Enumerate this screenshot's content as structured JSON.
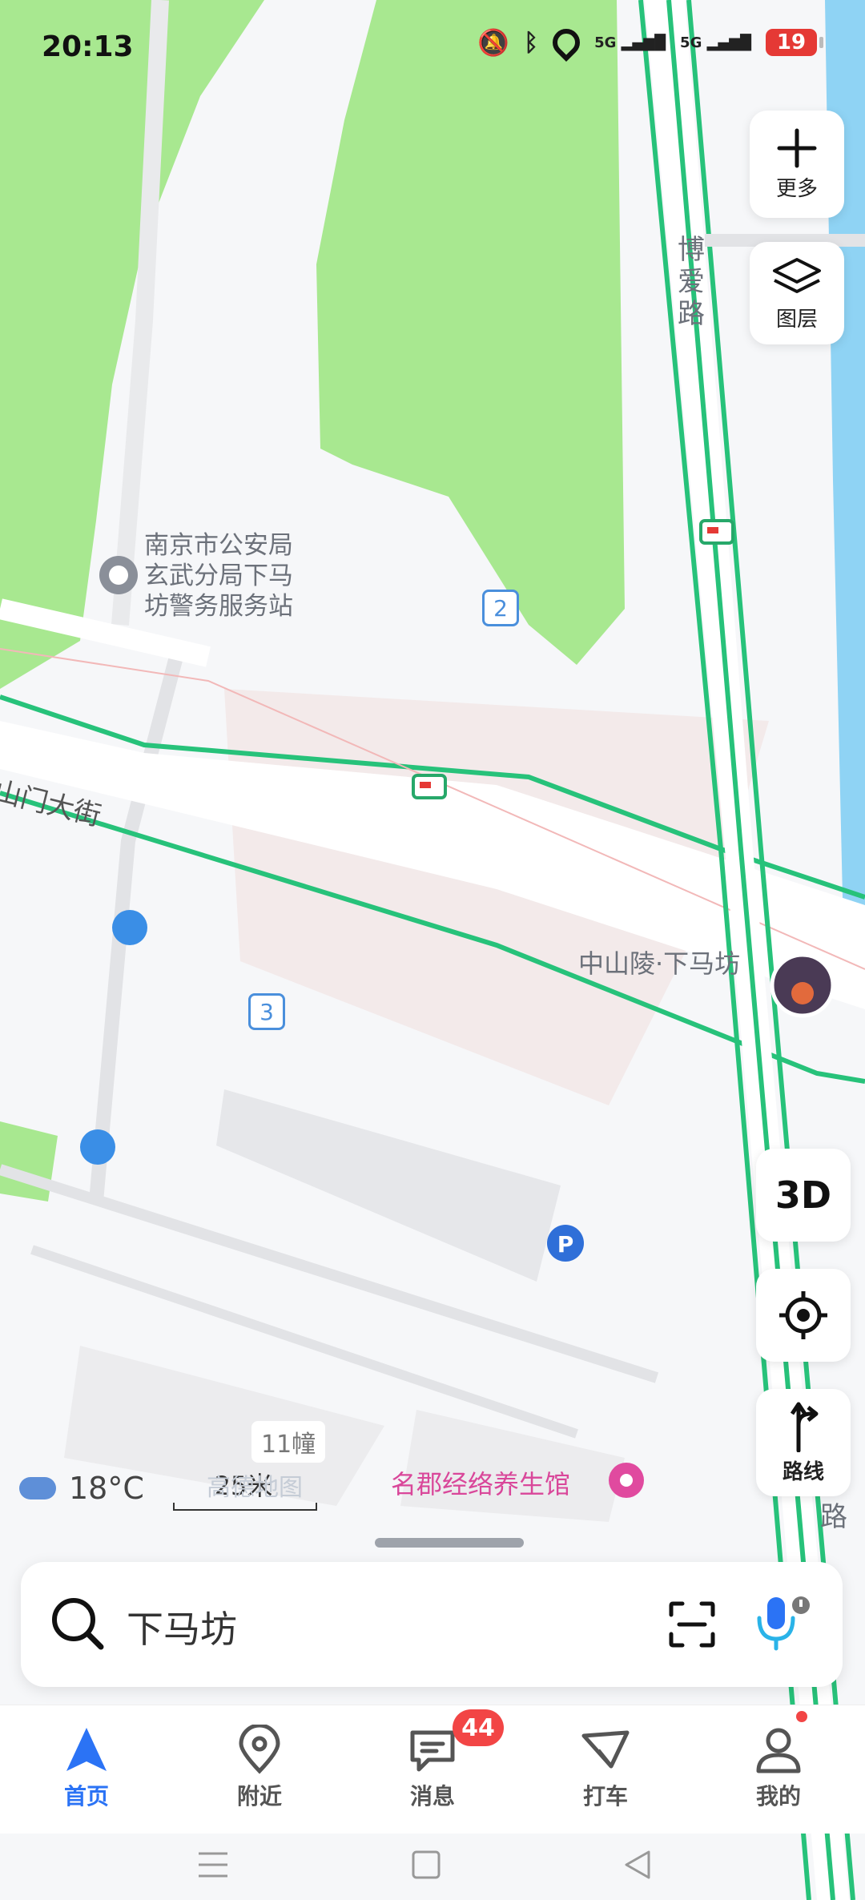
{
  "status_bar": {
    "time": "20:13",
    "network_1": "5G",
    "network_2": "5G",
    "battery": "19"
  },
  "map": {
    "poi_police_lines": [
      "南京市公安局",
      "玄武分局下马",
      "坊警务服务站"
    ],
    "road_boai": "博爱路",
    "road_zhongshanmen": "山门大街",
    "exit_2": "2",
    "exit_3": "3",
    "station_label": "中山陵·下马坊",
    "building_label": "11幢",
    "spa_label": "名郡经络养生馆",
    "road_right_lower": "路",
    "weather_temp": "18°C",
    "scale_label": "25米",
    "watermark": "高德地图"
  },
  "right_controls": {
    "more_label": "更多",
    "layers_label": "图层",
    "three_d_label": "3D",
    "route_label": "路线"
  },
  "search": {
    "query": "下马坊"
  },
  "tabs": [
    {
      "label": "首页"
    },
    {
      "label": "附近"
    },
    {
      "label": "消息"
    },
    {
      "label": "打车"
    },
    {
      "label": "我的"
    }
  ],
  "messages_badge": "44",
  "colors": {
    "accent": "#2b73f5",
    "park_green": "#a8e890",
    "road_green": "#27c27a",
    "water_blue": "#8fd3f4",
    "badge_red": "#f24545",
    "spa_pink": "#e04a9f"
  }
}
